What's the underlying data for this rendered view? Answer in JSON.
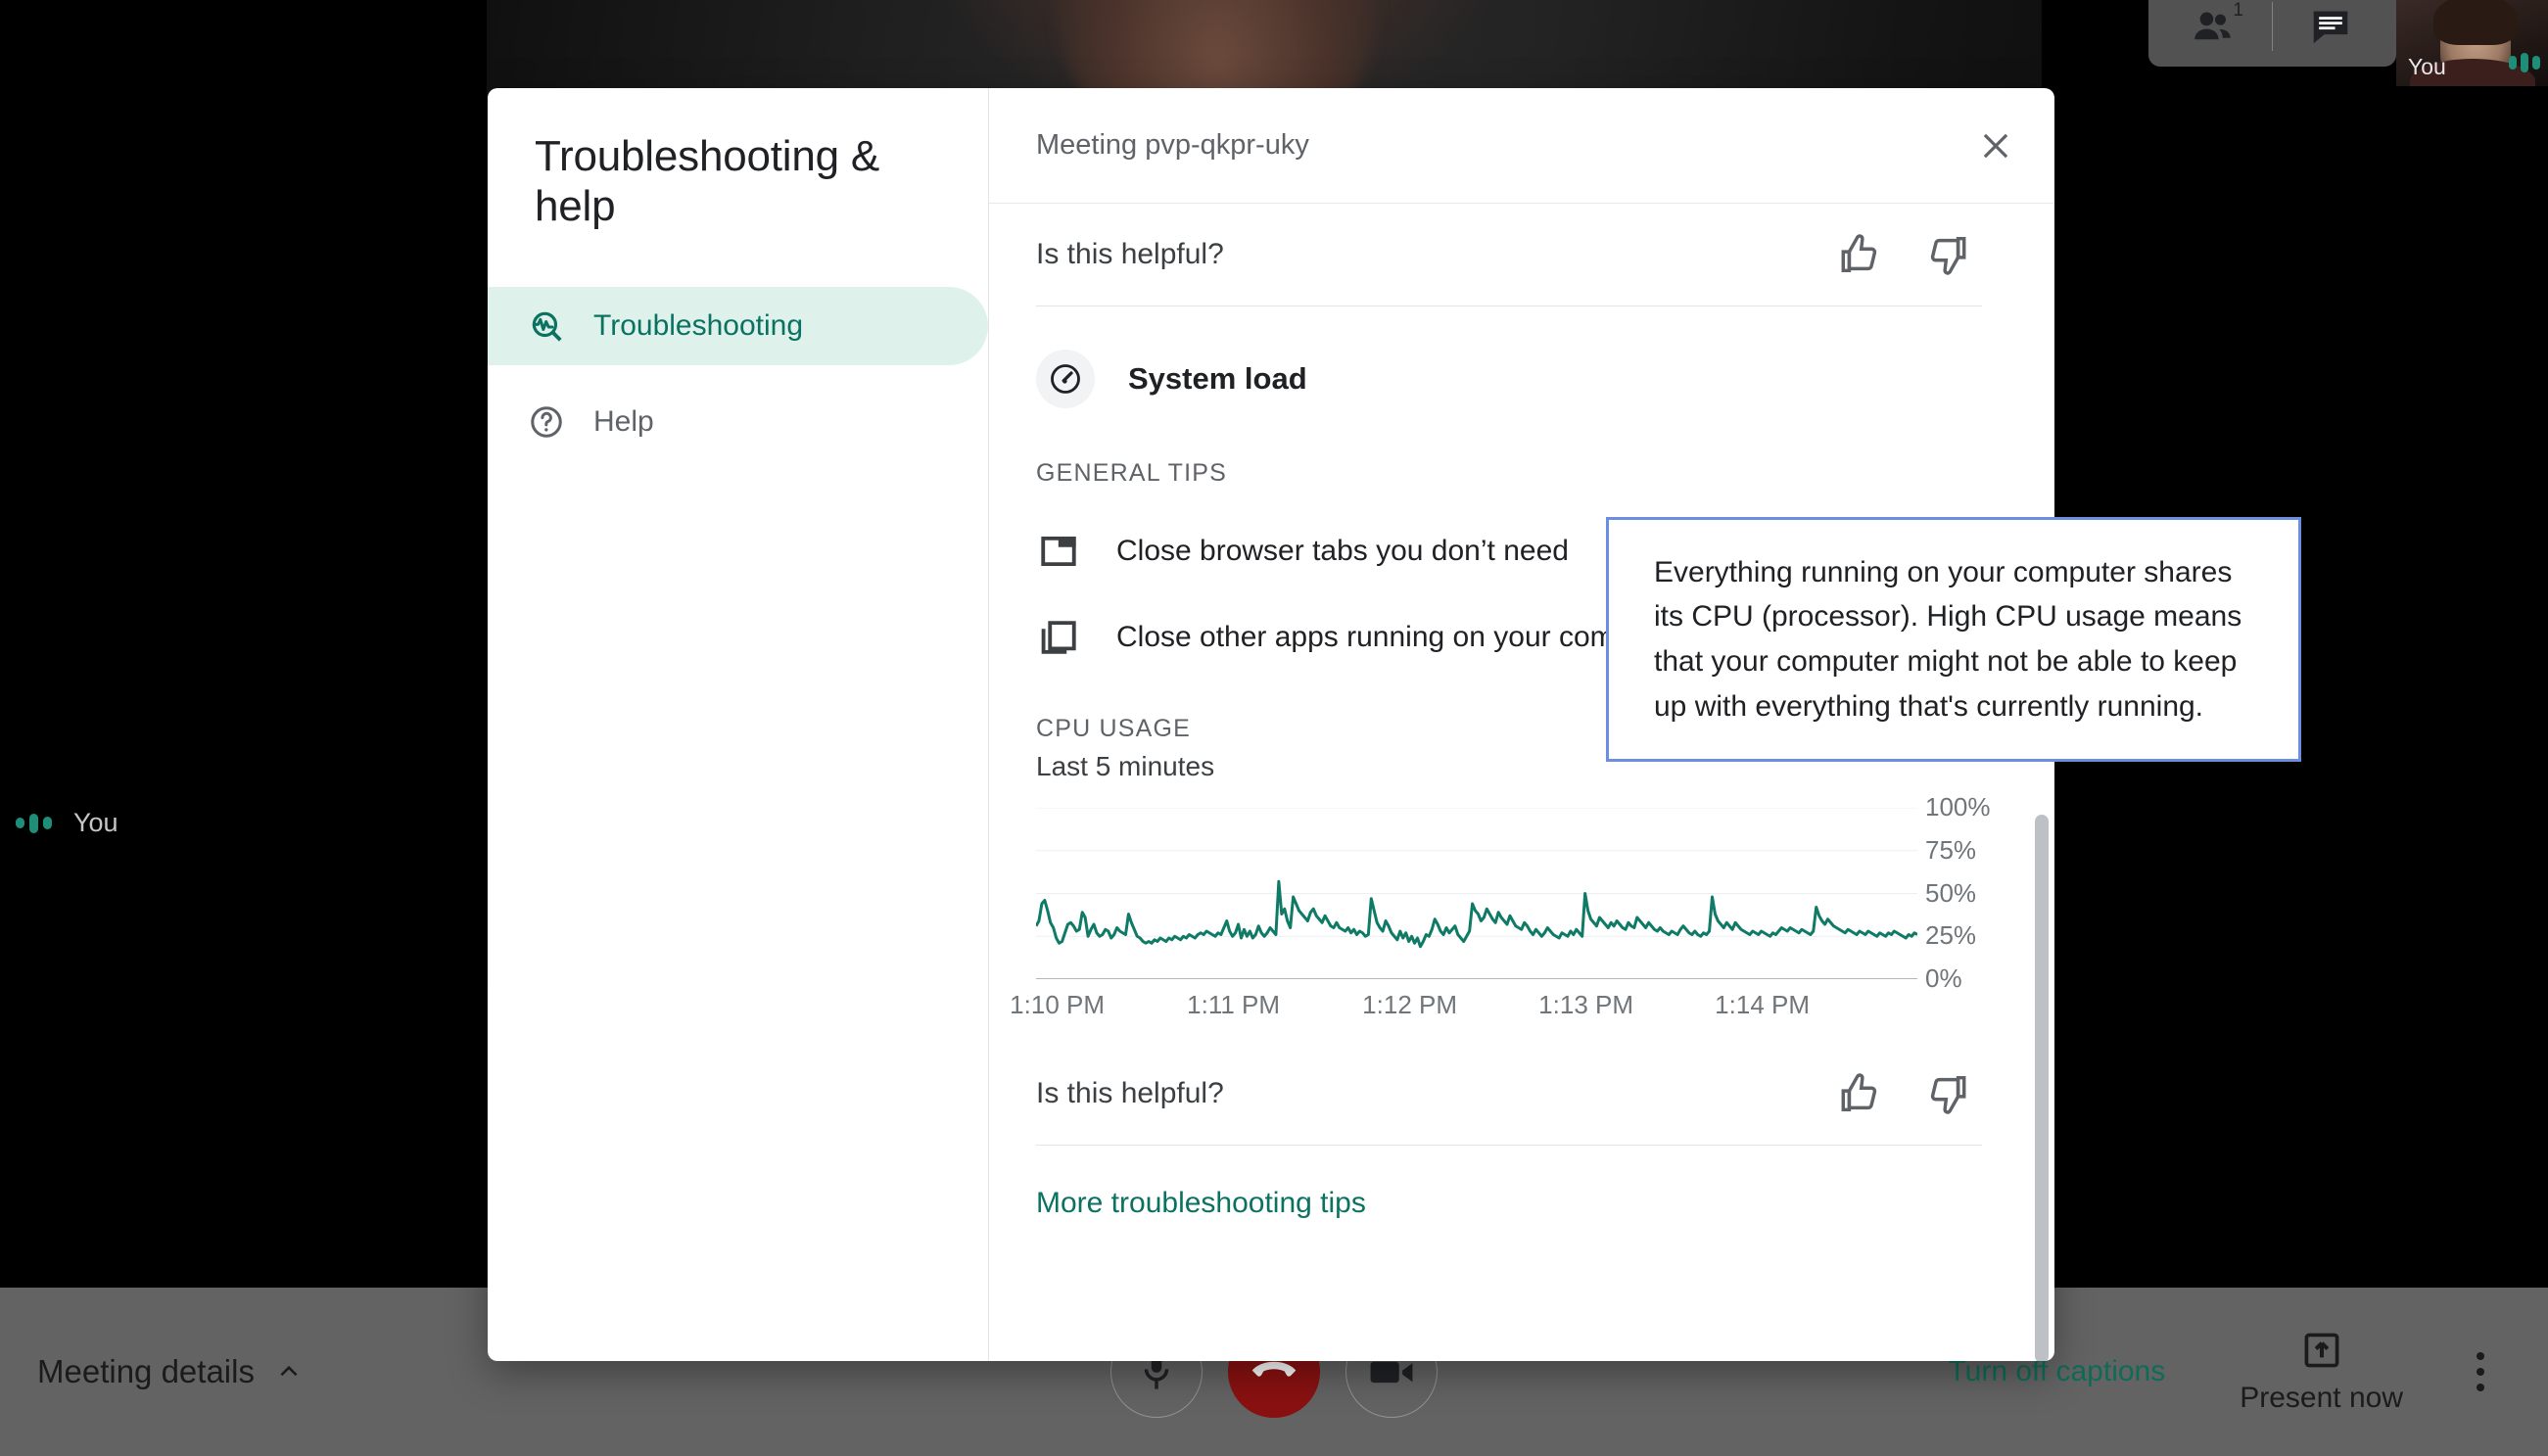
{
  "meet": {
    "self_view_label": "You",
    "left_speaker_label": "You",
    "participants_count": "1",
    "participants_icon": "people-icon",
    "chat_icon": "chat-bubble-icon",
    "bottom_bar": {
      "meeting_details_label": "Meeting details",
      "meeting_details_chevron": "chevron-up-icon",
      "mic_icon": "microphone-icon",
      "hangup_icon": "end-call-icon",
      "camera_icon": "video-camera-icon",
      "captions_label": "Turn off captions",
      "present_label": "Present now",
      "present_icon": "present-screen-icon",
      "more_icon": "more-vertical-icon"
    }
  },
  "dialog": {
    "title": "Troubleshooting & help",
    "header_title": "Meeting pvp-qkpr-uky",
    "close_icon": "close-icon",
    "sidebar": [
      {
        "label": "Troubleshooting",
        "icon": "troubleshooting-magnifier-icon",
        "active": true
      },
      {
        "label": "Help",
        "icon": "help-circle-icon",
        "active": false
      }
    ],
    "helpful_top": {
      "label": "Is this helpful?",
      "thumb_up_icon": "thumb-up-icon",
      "thumb_down_icon": "thumb-down-icon"
    },
    "system_load": {
      "title": "System load",
      "icon": "speedometer-icon"
    },
    "general_tips": {
      "label": "GENERAL TIPS",
      "items": [
        {
          "text": "Close browser tabs you don’t need",
          "icon": "browser-tab-icon"
        },
        {
          "text": "Close other apps running on your computer",
          "icon": "stacked-windows-icon"
        }
      ]
    },
    "cpu_help_icon": "help-circle-icon",
    "helpful_bottom": {
      "label": "Is this helpful?",
      "thumb_up_icon": "thumb-up-icon",
      "thumb_down_icon": "thumb-down-icon"
    },
    "more_tips_label": "More troubleshooting tips",
    "accent_green": "#0b7261",
    "chart_line_color": "#0f7a66",
    "tooltip_border": "#6b8fe0"
  },
  "tooltip": {
    "text": "Everything running on your computer shares its CPU (processor). High CPU usage means that your computer might not be able to keep up with everything that's currently running."
  },
  "chart_data": {
    "type": "line",
    "title": "CPU USAGE",
    "subtitle": "Last 5 minutes",
    "xlabel": "",
    "ylabel": "",
    "ylim": [
      0,
      100
    ],
    "yticks": [
      0,
      25,
      50,
      75,
      100
    ],
    "ytick_labels": [
      "0%",
      "25%",
      "50%",
      "75%",
      "100%"
    ],
    "xtick_labels": [
      "1:10 PM",
      "1:11 PM",
      "1:12 PM",
      "1:13 PM",
      "1:14 PM"
    ],
    "grid": true,
    "legend": false,
    "series": [
      {
        "name": "CPU usage",
        "color": "#0f7a66",
        "values": [
          31,
          34,
          44,
          46,
          40,
          33,
          30,
          24,
          21,
          22,
          27,
          32,
          33,
          31,
          28,
          29,
          39,
          36,
          25,
          29,
          32,
          27,
          25,
          26,
          29,
          28,
          24,
          26,
          30,
          28,
          27,
          26,
          38,
          33,
          29,
          25,
          24,
          22,
          21,
          22,
          21,
          23,
          22,
          24,
          23,
          22,
          24,
          23,
          25,
          24,
          23,
          25,
          24,
          26,
          25,
          24,
          26,
          27,
          26,
          28,
          27,
          26,
          25,
          27,
          26,
          30,
          34,
          28,
          25,
          27,
          32,
          24,
          29,
          25,
          28,
          24,
          26,
          31,
          27,
          25,
          27,
          30,
          28,
          26,
          57,
          38,
          41,
          34,
          30,
          48,
          44,
          40,
          38,
          36,
          34,
          39,
          41,
          37,
          35,
          33,
          37,
          34,
          31,
          30,
          33,
          30,
          29,
          28,
          30,
          27,
          29,
          26,
          28,
          27,
          25,
          26,
          47,
          40,
          33,
          30,
          28,
          34,
          31,
          27,
          25,
          23,
          28,
          24,
          27,
          22,
          25,
          21,
          24,
          19,
          22,
          26,
          25,
          29,
          35,
          32,
          28,
          26,
          30,
          27,
          29,
          31,
          26,
          24,
          22,
          25,
          28,
          44,
          40,
          38,
          34,
          36,
          41,
          38,
          35,
          33,
          39,
          36,
          34,
          32,
          37,
          34,
          31,
          30,
          29,
          33,
          31,
          28,
          26,
          29,
          27,
          25,
          27,
          30,
          28,
          26,
          25,
          24,
          27,
          26,
          25,
          28,
          26,
          29,
          27,
          25,
          50,
          40,
          35,
          33,
          31,
          36,
          34,
          32,
          30,
          33,
          31,
          34,
          32,
          30,
          29,
          33,
          31,
          30,
          36,
          34,
          32,
          30,
          33,
          31,
          29,
          28,
          30,
          28,
          27,
          26,
          28,
          27,
          26,
          29,
          31,
          29,
          27,
          26,
          28,
          26,
          25,
          27,
          26,
          28,
          48,
          38,
          34,
          32,
          30,
          33,
          31,
          29,
          33,
          31,
          29,
          28,
          27,
          26,
          28,
          27,
          26,
          28,
          27,
          26,
          25,
          27,
          26,
          28,
          30,
          29,
          28,
          30,
          29,
          28,
          27,
          29,
          28,
          27,
          26,
          28,
          42,
          37,
          34,
          32,
          35,
          33,
          31,
          30,
          29,
          28,
          27,
          29,
          28,
          27,
          26,
          28,
          27,
          26,
          28,
          27,
          26,
          25,
          27,
          26,
          25,
          27,
          26,
          28,
          27,
          26,
          25,
          24,
          26,
          25,
          27,
          26
        ]
      }
    ]
  }
}
